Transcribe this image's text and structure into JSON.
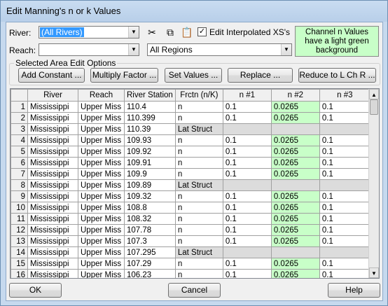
{
  "window": {
    "title": "Edit Manning's n or k Values"
  },
  "filters": {
    "river_label": "River:",
    "river_value": "(All Rivers)",
    "reach_label": "Reach:",
    "reach_value": "",
    "regions_value": "All Regions",
    "edit_interpolated_label": "Edit Interpolated XS's",
    "edit_interpolated_checked": true,
    "check_mark": "✓"
  },
  "toolbar": {
    "cut_icon": "✂",
    "copy_icon": "⧉",
    "paste_icon": "📋"
  },
  "note": "Channel n Values have a light green background",
  "area_edit": {
    "legend": "Selected Area Edit Options",
    "add_constant": "Add Constant ...",
    "multiply_factor": "Multiply Factor ...",
    "set_values": "Set Values ...",
    "replace": "Replace ...",
    "reduce": "Reduce to L Ch R ..."
  },
  "table": {
    "headers": [
      "",
      "River",
      "Reach",
      "River Station",
      "Frctn (n/K)",
      "n #1",
      "n #2",
      "n #3"
    ],
    "rows": [
      [
        "1",
        "Mississippi",
        "Upper Miss",
        "110.4",
        "n",
        "0.1",
        "0.0265",
        "0.1"
      ],
      [
        "2",
        "Mississippi",
        "Upper Miss",
        "110.399",
        "n",
        "0.1",
        "0.0265",
        "0.1"
      ],
      [
        "3",
        "Mississippi",
        "Upper Miss",
        "110.39",
        "Lat Struct",
        "",
        "",
        ""
      ],
      [
        "4",
        "Mississippi",
        "Upper Miss",
        "109.93",
        "n",
        "0.1",
        "0.0265",
        "0.1"
      ],
      [
        "5",
        "Mississippi",
        "Upper Miss",
        "109.92",
        "n",
        "0.1",
        "0.0265",
        "0.1"
      ],
      [
        "6",
        "Mississippi",
        "Upper Miss",
        "109.91",
        "n",
        "0.1",
        "0.0265",
        "0.1"
      ],
      [
        "7",
        "Mississippi",
        "Upper Miss",
        "109.9",
        "n",
        "0.1",
        "0.0265",
        "0.1"
      ],
      [
        "8",
        "Mississippi",
        "Upper Miss",
        "109.89",
        "Lat Struct",
        "",
        "",
        ""
      ],
      [
        "9",
        "Mississippi",
        "Upper Miss",
        "109.32",
        "n",
        "0.1",
        "0.0265",
        "0.1"
      ],
      [
        "10",
        "Mississippi",
        "Upper Miss",
        "108.8",
        "n",
        "0.1",
        "0.0265",
        "0.1"
      ],
      [
        "11",
        "Mississippi",
        "Upper Miss",
        "108.32",
        "n",
        "0.1",
        "0.0265",
        "0.1"
      ],
      [
        "12",
        "Mississippi",
        "Upper Miss",
        "107.78",
        "n",
        "0.1",
        "0.0265",
        "0.1"
      ],
      [
        "13",
        "Mississippi",
        "Upper Miss",
        "107.3",
        "n",
        "0.1",
        "0.0265",
        "0.1"
      ],
      [
        "14",
        "Mississippi",
        "Upper Miss",
        "107.295",
        "Lat Struct",
        "",
        "",
        ""
      ],
      [
        "15",
        "Mississippi",
        "Upper Miss",
        "107.29",
        "n",
        "0.1",
        "0.0265",
        "0.1"
      ],
      [
        "16",
        "Mississippi",
        "Upper Miss",
        "106.23",
        "n",
        "0.1",
        "0.0265",
        "0.1"
      ]
    ]
  },
  "footer": {
    "ok": "OK",
    "cancel": "Cancel",
    "help": "Help"
  },
  "colors": {
    "channel_green": "#c8ffc8",
    "lat_struct_gray": "#dcdcdc",
    "selection_blue": "#3399ff"
  }
}
